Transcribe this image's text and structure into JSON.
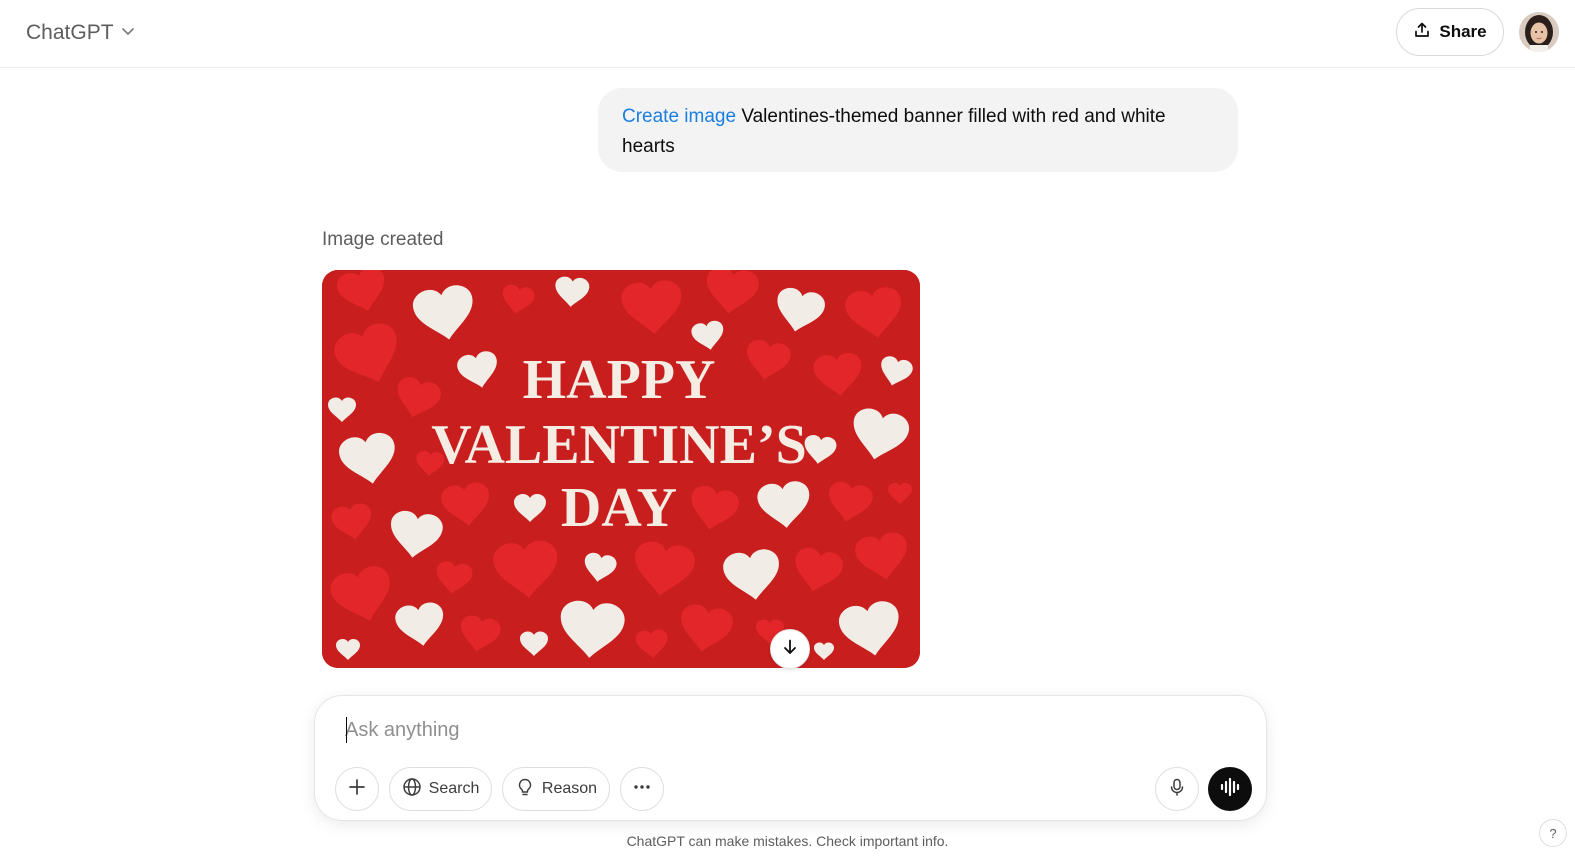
{
  "header": {
    "model_name": "ChatGPT",
    "share_label": "Share"
  },
  "conversation": {
    "user_message": {
      "tool_tag": "Create image",
      "text": "Valentines-themed banner filled with red and white hearts"
    },
    "assistant": {
      "status": "Image created",
      "image": {
        "headline": [
          "HAPPY",
          "VALENTINE’S",
          "DAY"
        ],
        "background_color": "#c81e1e",
        "heart_colors": [
          "#e3262a",
          "#f1ece6"
        ]
      }
    }
  },
  "composer": {
    "placeholder": "Ask anything",
    "search_label": "Search",
    "reason_label": "Reason"
  },
  "footer": {
    "disclaimer": "ChatGPT can make mistakes. Check important info.",
    "help_label": "?"
  },
  "colors": {
    "accent": "#1a7fe0",
    "bubble": "#f3f3f3"
  }
}
